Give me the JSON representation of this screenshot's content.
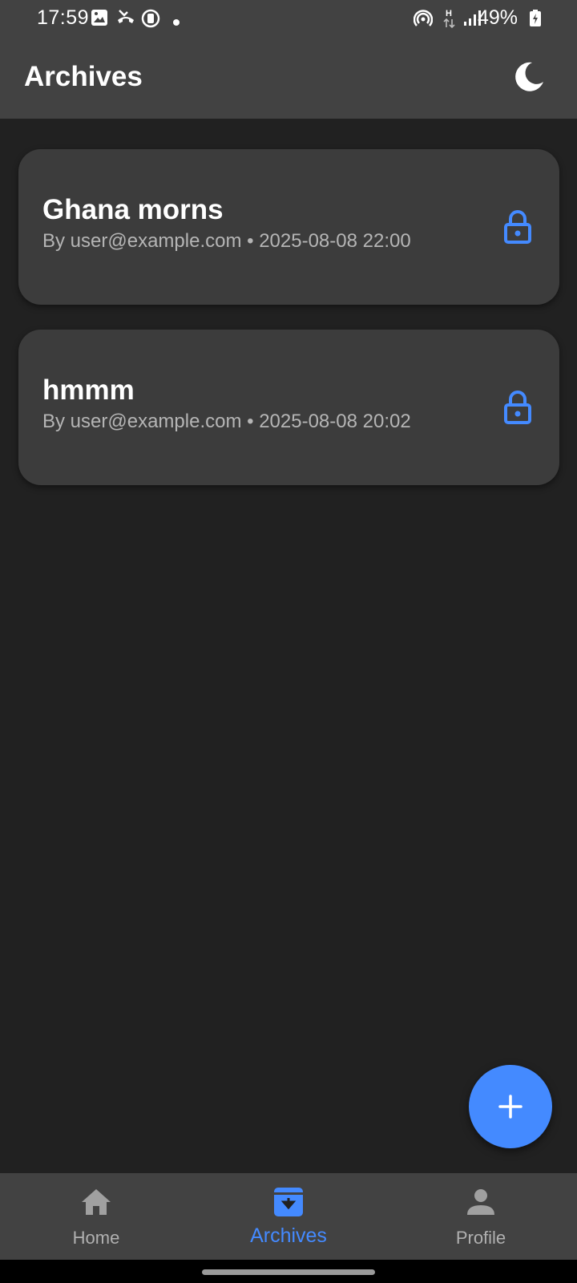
{
  "status_bar": {
    "time": "17:59",
    "battery": "49%"
  },
  "app_bar": {
    "title": "Archives",
    "theme_toggle_icon": "moon-icon"
  },
  "archives": [
    {
      "title": "Ghana morns",
      "meta": "By user@example.com • 2025-08-08 22:00",
      "icon": "lock-icon"
    },
    {
      "title": "hmmm",
      "meta": "By user@example.com • 2025-08-08 20:02",
      "icon": "lock-icon"
    }
  ],
  "fab": {
    "icon": "plus-icon"
  },
  "bottom_nav": {
    "items": [
      {
        "label": "Home",
        "icon": "home-icon",
        "active": false
      },
      {
        "label": "Archives",
        "icon": "archive-icon",
        "active": true
      },
      {
        "label": "Profile",
        "icon": "person-icon",
        "active": false
      }
    ]
  },
  "colors": {
    "accent": "#448aff",
    "background": "#212121",
    "surface": "#3c3c3c",
    "bar": "#424242"
  }
}
